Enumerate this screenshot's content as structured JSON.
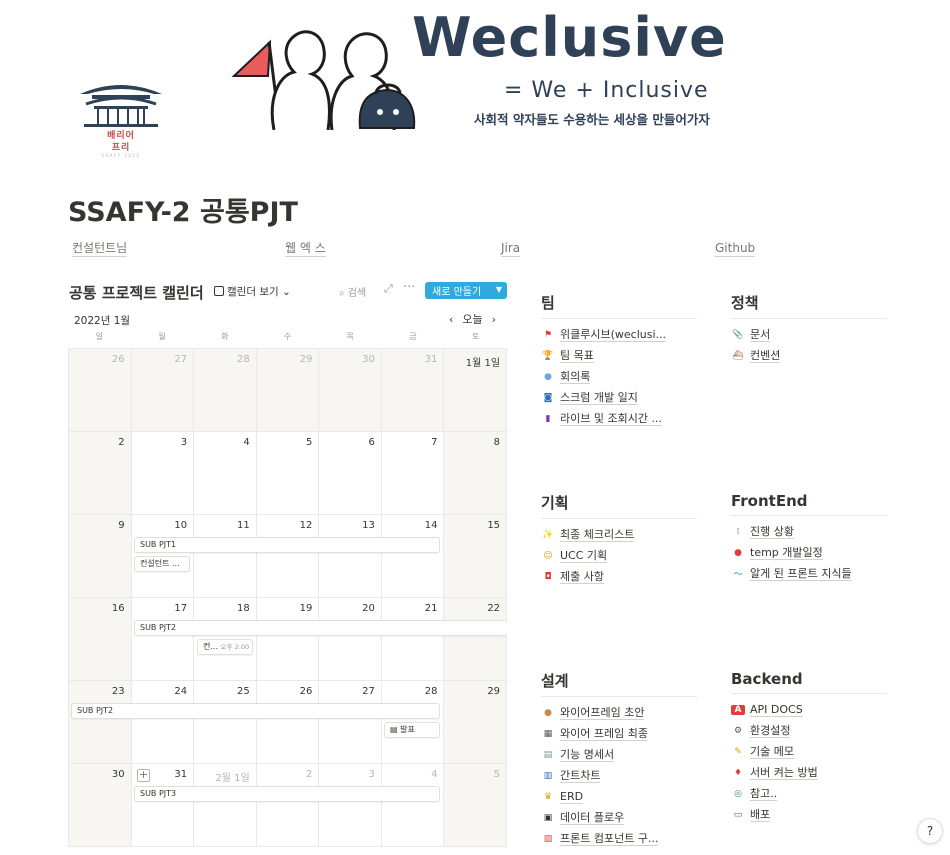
{
  "banner": {
    "logo_line1": "배리어",
    "logo_line2": "프리",
    "logo_line3": "SSAFY 2022",
    "brand_title": "Weclusive",
    "brand_sub": "= We + Inclusive",
    "brand_tagline": "사회적 약자들도 수용하는 세상을 만들어가자"
  },
  "page": {
    "title": "SSAFY-2 공통PJT"
  },
  "links": [
    {
      "label": "컨설턴트님"
    },
    {
      "label": "웹 엑 스"
    },
    {
      "label": "Jira"
    },
    {
      "label": "Github"
    }
  ],
  "calendar": {
    "title": "공통 프로젝트 캘린더",
    "view_label": "캘린더 보기",
    "search_label": "검색",
    "new_button": "새로 만들기",
    "month_label": "2022년 1월",
    "today_label": "오늘",
    "weekdays": [
      "일",
      "월",
      "화",
      "수",
      "목",
      "금",
      "토"
    ],
    "weeks": [
      [
        "26",
        "27",
        "28",
        "29",
        "30",
        "31",
        "1월 1일"
      ],
      [
        "2",
        "3",
        "4",
        "5",
        "6",
        "7",
        "8"
      ],
      [
        "9",
        "10",
        "11",
        "12",
        "13",
        "14",
        "15"
      ],
      [
        "16",
        "17",
        "18",
        "19",
        "20",
        "21",
        "22"
      ],
      [
        "23",
        "24",
        "25",
        "26",
        "27",
        "28",
        "29"
      ],
      [
        "30",
        "31",
        "2월 1일",
        "2",
        "3",
        "4",
        "5"
      ]
    ],
    "events": {
      "sub1": "SUB PJT1",
      "consult1": "컨설턴트 ...",
      "sub2a": "SUB PJT2",
      "consult2": "컨...",
      "consult2_time": "오후 2:00",
      "sub2b": "SUB PJT2",
      "present": "발표",
      "sub3": "SUB PJT3"
    }
  },
  "sections": {
    "team": {
      "title": "팀",
      "items": [
        {
          "label": "위클루시브(weclusi...",
          "icon": "red-flag"
        },
        {
          "label": "팀 목표",
          "icon": "trophy"
        },
        {
          "label": "회의록",
          "icon": "speech-bubble"
        },
        {
          "label": "스크럼 개발 일지",
          "icon": "blue-square"
        },
        {
          "label": "라이브 및 조회시간 ...",
          "icon": "bookmark"
        }
      ]
    },
    "policy": {
      "title": "정책",
      "items": [
        {
          "label": "문서",
          "icon": "paperclip"
        },
        {
          "label": "컨벤션",
          "icon": "ship"
        }
      ]
    },
    "planning": {
      "title": "기획",
      "items": [
        {
          "label": "최종 체크리스트",
          "icon": "sparkles"
        },
        {
          "label": "UCC 기획",
          "icon": "smile"
        },
        {
          "label": "제출 사항",
          "icon": "siren"
        }
      ]
    },
    "frontend": {
      "title": "FrontEnd",
      "items": [
        {
          "label": "진행 상황",
          "icon": "abacus"
        },
        {
          "label": "temp 개발일정",
          "icon": "red-circle"
        },
        {
          "label": "알게 된 프론트 지식들",
          "icon": "wave"
        }
      ]
    },
    "design": {
      "title": "설계",
      "items": [
        {
          "label": "와이어프레임 초안",
          "icon": "cookie"
        },
        {
          "label": "와이어 프레임 최종",
          "icon": "calculator"
        },
        {
          "label": "기능 명세서",
          "icon": "pages"
        },
        {
          "label": "간트차트",
          "icon": "bar-chart"
        },
        {
          "label": "ERD",
          "icon": "crown"
        },
        {
          "label": "데이터 플로우",
          "icon": "floppy"
        },
        {
          "label": "프론트 컴포넌트 구...",
          "icon": "blocks"
        }
      ]
    },
    "backend": {
      "title": "Backend",
      "items": [
        {
          "label": "API DOCS",
          "icon": "red-a"
        },
        {
          "label": "환경설정",
          "icon": "gear"
        },
        {
          "label": "기술 메모",
          "icon": "memo"
        },
        {
          "label": "서버 켜는 방법",
          "icon": "red-diamond"
        },
        {
          "label": "참고..",
          "icon": "eye-glasses"
        },
        {
          "label": "배포",
          "icon": "monitor"
        }
      ]
    }
  },
  "help_label": "?"
}
